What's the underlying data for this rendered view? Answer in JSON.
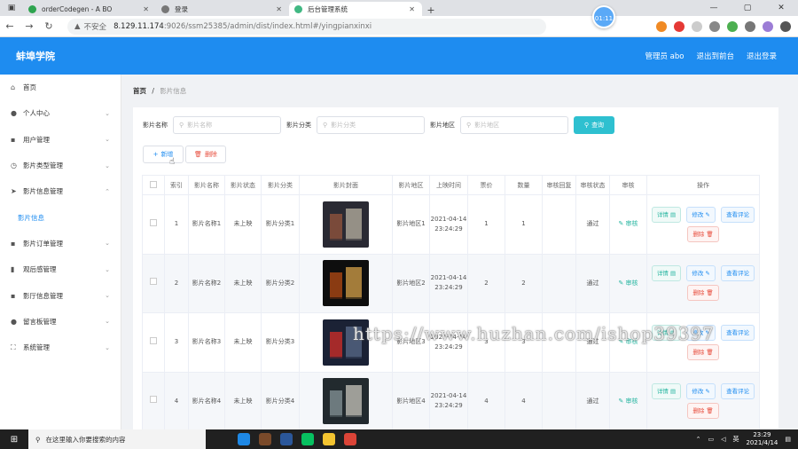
{
  "browser": {
    "tabs": [
      {
        "label": "orderCodegen - A BO",
        "active": false,
        "color": "#2ea44f"
      },
      {
        "label": "登录",
        "active": false,
        "color": "#777777"
      },
      {
        "label": "后台管理系统",
        "active": true,
        "color": "#41b883"
      }
    ],
    "address": {
      "security": "不安全",
      "host": "8.129.11.174",
      "path": ":9026/ssm25385/admin/dist/index.html#/yingpianxinxi"
    },
    "timer": "01:11"
  },
  "header": {
    "brand": "蚌埠学院",
    "links": [
      "管理员 abo",
      "退出到前台",
      "退出登录"
    ]
  },
  "sidebar": {
    "items": [
      {
        "label": "首页",
        "icon": "home-icon",
        "glyph": "⌂",
        "chev": ""
      },
      {
        "label": "个人中心",
        "icon": "user-icon",
        "glyph": "●",
        "chev": "⌄"
      },
      {
        "label": "用户管理",
        "icon": "users-icon",
        "glyph": "▪",
        "chev": "⌄"
      },
      {
        "label": "影片类型管理",
        "icon": "clock-icon",
        "glyph": "◷",
        "chev": "⌄"
      },
      {
        "label": "影片信息管理",
        "icon": "send-icon",
        "glyph": "➤",
        "chev": "⌃"
      },
      {
        "label": "影片信息",
        "icon": "",
        "glyph": "",
        "chev": "",
        "sub": true
      },
      {
        "label": "影片订单管理",
        "icon": "order-icon",
        "glyph": "▪",
        "chev": "⌄"
      },
      {
        "label": "观后感管理",
        "icon": "chart-icon",
        "glyph": "▮",
        "chev": "⌄"
      },
      {
        "label": "影厅信息管理",
        "icon": "hall-icon",
        "glyph": "▪",
        "chev": "⌄"
      },
      {
        "label": "留言板管理",
        "icon": "pin-icon",
        "glyph": "●",
        "chev": "⌄"
      },
      {
        "label": "系统管理",
        "icon": "system-icon",
        "glyph": "⛶",
        "chev": "⌄"
      }
    ]
  },
  "breadcrumb": {
    "home": "首页",
    "sep": "/",
    "current": "影片信息"
  },
  "search": {
    "fields": [
      {
        "label": "影片名称",
        "placeholder": "影片名称"
      },
      {
        "label": "影片分类",
        "placeholder": "影片分类"
      },
      {
        "label": "影片地区",
        "placeholder": "影片地区"
      }
    ],
    "query_label": "查询"
  },
  "actions": {
    "add": "新增",
    "delete": "删除"
  },
  "table": {
    "headers": [
      "索引",
      "影片名称",
      "影片状态",
      "影片分类",
      "影片封面",
      "影片地区",
      "上映时间",
      "票价",
      "数量",
      "审核回复",
      "审核状态",
      "审核",
      "操作"
    ],
    "rows": [
      {
        "idx": "1",
        "name": "影片名称1",
        "status": "未上映",
        "category": "影片分类1",
        "region": "影片地区1",
        "time": "2021-04-14 23:24:29",
        "price": "1",
        "qty": "1",
        "reply": "",
        "audit_status": "通过",
        "audit": "审核",
        "cover": [
          "#2a2a33",
          "#7a4a3a",
          "#b9b3a3"
        ]
      },
      {
        "idx": "2",
        "name": "影片名称2",
        "status": "未上映",
        "category": "影片分类2",
        "region": "影片地区2",
        "time": "2021-04-14 23:24:29",
        "price": "2",
        "qty": "2",
        "reply": "",
        "audit_status": "通过",
        "audit": "审核",
        "cover": [
          "#0e0e0e",
          "#8a3b12",
          "#d6a14a"
        ]
      },
      {
        "idx": "3",
        "name": "影片名称3",
        "status": "未上映",
        "category": "影片分类3",
        "region": "影片地区3",
        "time": "2021-04-14 23:24:29",
        "price": "3",
        "qty": "3",
        "reply": "",
        "audit_status": "通过",
        "audit": "审核",
        "cover": [
          "#1b2235",
          "#a52a2a",
          "#5a6b8a"
        ]
      },
      {
        "idx": "4",
        "name": "影片名称4",
        "status": "未上映",
        "category": "影片分类4",
        "region": "影片地区4",
        "time": "2021-04-14 23:24:29",
        "price": "4",
        "qty": "4",
        "reply": "",
        "audit_status": "通过",
        "audit": "审核",
        "cover": [
          "#222a2e",
          "#6d7a7e",
          "#c8c6bc"
        ]
      }
    ],
    "op_labels": {
      "detail": "详情",
      "edit": "修改",
      "comment": "查看评论",
      "delete": "删除"
    }
  },
  "watermark": "https://www.huzhan.com/ishop39397",
  "taskbar": {
    "search_placeholder": "在这里输入你要搜索的内容",
    "time": "23:29",
    "date": "2021/4/14"
  }
}
